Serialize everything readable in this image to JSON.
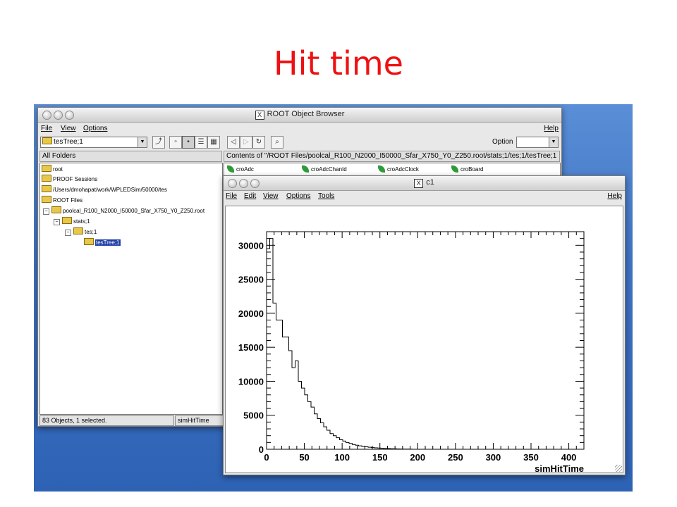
{
  "slide": {
    "title": "Hit time"
  },
  "browser": {
    "title": "ROOT Object Browser",
    "menu": {
      "file": "File",
      "view": "View",
      "options": "Options",
      "help": "Help"
    },
    "tree_combo": "tesTree;1",
    "option_label": "Option",
    "left_header": "All Folders",
    "right_header": "Contents of \"/ROOT Files/poolcal_R100_N2000_I50000_Sfar_X750_Y0_Z250.root/stats;1/tes;1/tesTree;1",
    "tree": [
      {
        "label": "root"
      },
      {
        "label": "PROOF Sessions"
      },
      {
        "label": "/Users/dmohapat/work/WPLEDSim/50000/tes"
      },
      {
        "label": "ROOT Files"
      },
      {
        "label": "poolcal_R100_N2000_I50000_Sfar_X750_Y0_Z250.root"
      },
      {
        "label": "stats;1"
      },
      {
        "label": "tes;1"
      },
      {
        "label": "tesTree;1"
      }
    ],
    "leaves": [
      "croAdc",
      "croAdcChanId",
      "croAdcClock",
      "croBoard"
    ],
    "status": {
      "left": "83 Objects, 1 selected.",
      "right": "simHitTime"
    }
  },
  "canvas_window": {
    "title": "c1",
    "menu": {
      "file": "File",
      "edit": "Edit",
      "view": "View",
      "options": "Options",
      "tools": "Tools",
      "help": "Help"
    }
  },
  "chart_data": {
    "type": "histogram",
    "xlabel": "simHitTime",
    "ylabel": "",
    "title": "",
    "xlim": [
      0,
      420
    ],
    "ylim": [
      0,
      32000
    ],
    "x_ticks": [
      0,
      50,
      100,
      150,
      200,
      250,
      300,
      350,
      400
    ],
    "y_ticks": [
      0,
      5000,
      10000,
      15000,
      20000,
      25000,
      30000
    ],
    "bin_width": 4.2,
    "counts": [
      29500,
      31000,
      21500,
      19000,
      19000,
      16500,
      16500,
      14500,
      12000,
      13000,
      10000,
      9000,
      8000,
      7000,
      6200,
      5200,
      4500,
      3900,
      3300,
      2800,
      2300,
      2000,
      1700,
      1400,
      1200,
      1000,
      850,
      700,
      600,
      500,
      420,
      360,
      300,
      250,
      210,
      180,
      150,
      120,
      100,
      80,
      60,
      50,
      40,
      30,
      20,
      10,
      0
    ]
  }
}
